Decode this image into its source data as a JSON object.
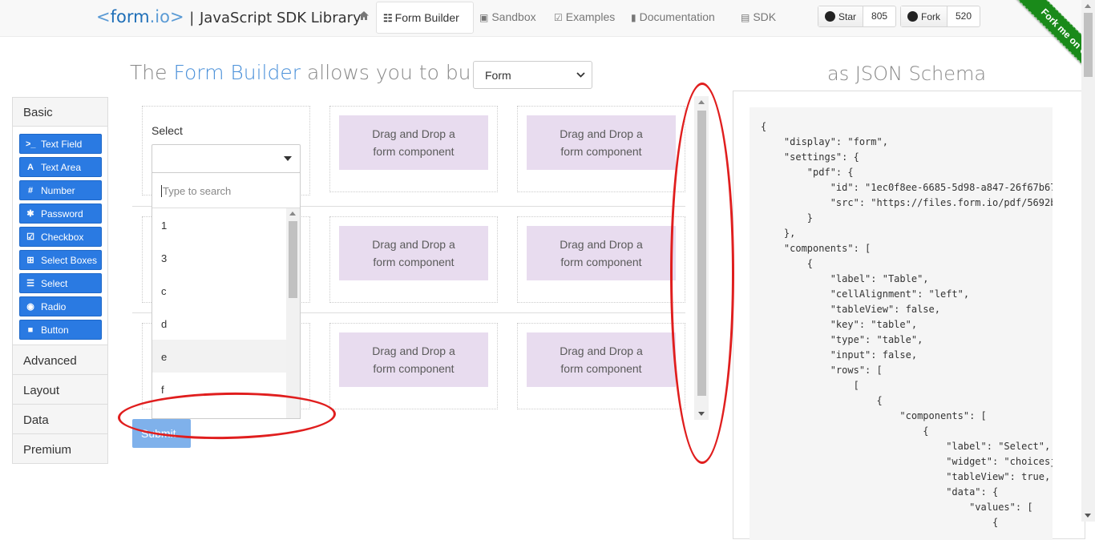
{
  "brand": {
    "left_bracket": "<",
    "name_a": "form",
    "name_b": ".io",
    "right_bracket": ">",
    "separator": "|",
    "subtitle": "JavaScript SDK Library"
  },
  "nav": {
    "home_icon": "home-icon",
    "items": [
      {
        "label": "Form Builder",
        "icon": "list-icon",
        "active": true
      },
      {
        "label": "Sandbox",
        "icon": "cube-icon"
      },
      {
        "label": "Examples",
        "icon": "check-square-icon"
      },
      {
        "label": "Documentation",
        "icon": "book-icon"
      },
      {
        "label": "SDK",
        "icon": "server-icon"
      }
    ],
    "github": {
      "star_label": "Star",
      "star_count": "805",
      "fork_label": "Fork",
      "fork_count": "520"
    },
    "ribbon": "Fork me on GitHub"
  },
  "headline": {
    "prefix": "The ",
    "highlight": "Form Builder",
    "suffix": " allows you to build a",
    "select_value": "Form",
    "json_title": "as JSON Schema"
  },
  "sidebar": {
    "basic_title": "Basic",
    "basic_items": [
      {
        "label": "Text Field",
        "icon": ">_"
      },
      {
        "label": "Text Area",
        "icon": "A"
      },
      {
        "label": "Number",
        "icon": "#"
      },
      {
        "label": "Password",
        "icon": "✱"
      },
      {
        "label": "Checkbox",
        "icon": "☑"
      },
      {
        "label": "Select Boxes",
        "icon": "⊞"
      },
      {
        "label": "Select",
        "icon": "☰"
      },
      {
        "label": "Radio",
        "icon": "◉"
      },
      {
        "label": "Button",
        "icon": "■"
      }
    ],
    "groups": [
      "Advanced",
      "Layout",
      "Data",
      "Premium"
    ]
  },
  "builder": {
    "select_label": "Select",
    "dnd_text_1": "Drag and Drop a",
    "dnd_text_2": "form component",
    "search_placeholder": "Type to search",
    "options": [
      "1",
      "3",
      "c",
      "d",
      "e",
      "f"
    ],
    "highlighted_option": "e",
    "submit_label": "Submit"
  },
  "json_schema": "{\n    \"display\": \"form\",\n    \"settings\": {\n        \"pdf\": {\n            \"id\": \"1ec0f8ee-6685-5d98-a847-26f67b67\n            \"src\": \"https://files.form.io/pdf/5692b\n        }\n    },\n    \"components\": [\n        {\n            \"label\": \"Table\",\n            \"cellAlignment\": \"left\",\n            \"tableView\": false,\n            \"key\": \"table\",\n            \"type\": \"table\",\n            \"input\": false,\n            \"rows\": [\n                [\n                    {\n                        \"components\": [\n                            {\n                                \"label\": \"Select\",\n                                \"widget\": \"choicesj\n                                \"tableView\": true,\n                                \"data\": {\n                                    \"values\": [\n                                        {",
  "colors": {
    "primary": "#2a7ae2",
    "dnd_bg": "#e8dcef",
    "annotation": "#e01e1e",
    "ribbon": "#1a8a1a"
  }
}
